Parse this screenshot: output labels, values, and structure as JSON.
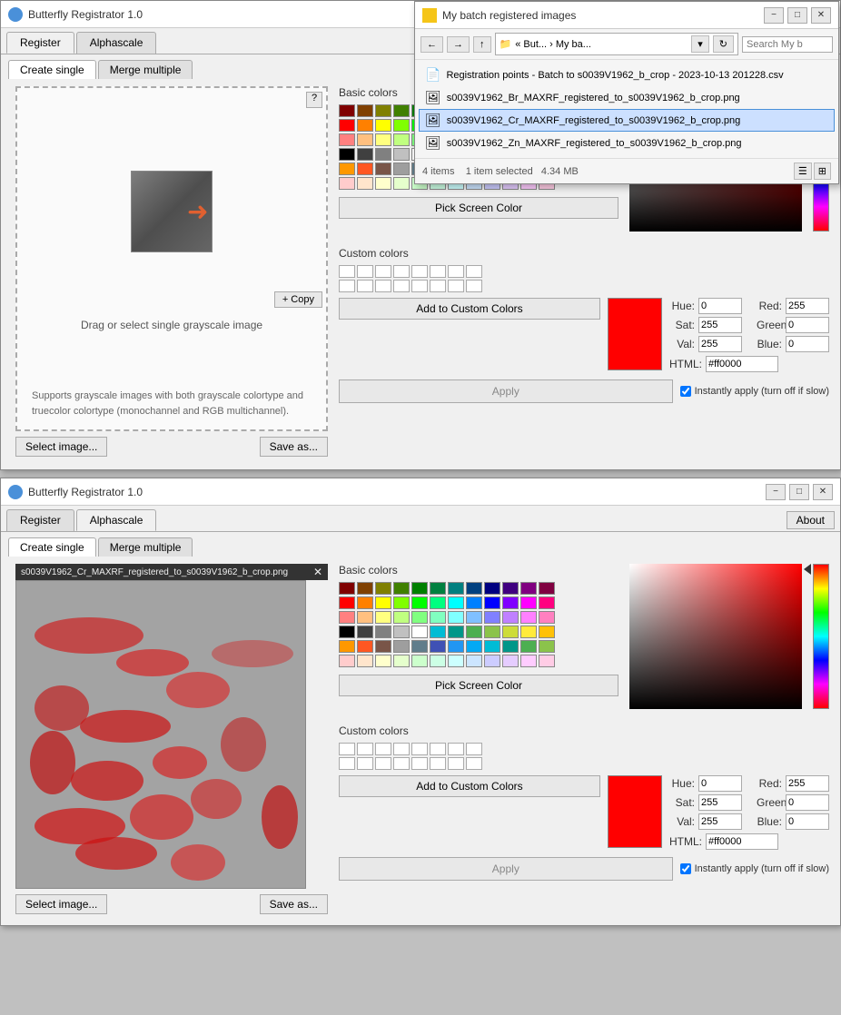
{
  "app": {
    "title": "Butterfly Registrator 1.0",
    "icon": "butterfly-icon"
  },
  "tabs": {
    "register_label": "Register",
    "alphascale_label": "Alphascale",
    "about_label": "About"
  },
  "inner_tabs": {
    "create_single_label": "Create single",
    "merge_multiple_label": "Merge multiple"
  },
  "drop_zone": {
    "help_label": "?",
    "copy_label": "+ Copy",
    "drag_label": "Drag or select single grayscale image",
    "info_text": "Supports grayscale images with both grayscale colortype and truecolor colortype (monochannel and RGB multichannel).",
    "select_btn": "Select image...",
    "save_as_btn": "Save as..."
  },
  "color_picker": {
    "basic_colors_label": "Basic colors",
    "pick_screen_label": "Pick Screen Color",
    "custom_colors_label": "Custom colors",
    "add_custom_label": "Add to Custom Colors",
    "apply_label": "Apply",
    "instantly_label": "Instantly apply (turn off if slow)",
    "hue_label": "Hue:",
    "sat_label": "Sat:",
    "val_label": "Val:",
    "red_label": "Red:",
    "green_label": "Green:",
    "blue_label": "Blue:",
    "html_label": "HTML:",
    "hue_val": "0",
    "sat_val": "255",
    "val_val": "255",
    "red_val": "255",
    "green_val": "0",
    "blue_val": "0",
    "html_val": "#ff0000"
  },
  "basic_colors": [
    "#800000",
    "#804000",
    "#808000",
    "#408000",
    "#008000",
    "#008040",
    "#008080",
    "#004080",
    "#000080",
    "#400080",
    "#800080",
    "#800040",
    "#ff0000",
    "#ff8000",
    "#ffff00",
    "#80ff00",
    "#00ff00",
    "#00ff80",
    "#00ffff",
    "#0080ff",
    "#0000ff",
    "#8000ff",
    "#ff00ff",
    "#ff0080",
    "#ff8080",
    "#ffc080",
    "#ffff80",
    "#c0ff80",
    "#80ff80",
    "#80ffc0",
    "#80ffff",
    "#80c0ff",
    "#8080ff",
    "#c080ff",
    "#ff80ff",
    "#ff80c0",
    "#000000",
    "#404040",
    "#808080",
    "#c0c0c0",
    "#ffffff",
    "#00bcd4",
    "#009688",
    "#4caf50",
    "#8bc34a",
    "#cddc39",
    "#ffeb3b",
    "#ffc107",
    "#ff9800",
    "#ff5722",
    "#795548",
    "#9e9e9e",
    "#607d8b",
    "#3f51b5",
    "#2196f3",
    "#03a9f4",
    "#00bcd5",
    "#009689",
    "#4caf51",
    "#8bc34b",
    "#ffcccc",
    "#ffe5cc",
    "#ffffcc",
    "#e5ffcc",
    "#ccffcc",
    "#ccffe5",
    "#ccffff",
    "#cce5ff",
    "#ccccff",
    "#e5ccff",
    "#ffccff",
    "#ffcce5"
  ],
  "file_browser": {
    "title": "My batch registered images",
    "addr": "« But... › My ba...",
    "search_placeholder": "Search My b",
    "files": [
      {
        "name": "Registration points - Batch to s0039V1962_b_crop - 2023-10-13 201228.csv",
        "type": "csv",
        "selected": false
      },
      {
        "name": "s0039V1962_Br_MAXRF_registered_to_s0039V1962_b_crop.png",
        "type": "png",
        "selected": false
      },
      {
        "name": "s0039V1962_Cr_MAXRF_registered_to_s0039V1962_b_crop.png",
        "type": "png",
        "selected": true
      },
      {
        "name": "s0039V1962_Zn_MAXRF_registered_to_s0039V1962_b_crop.png",
        "type": "png",
        "selected": false
      }
    ],
    "footer_items": "4 items",
    "footer_selected": "1 item selected",
    "footer_size": "4.34 MB"
  },
  "bottom_window": {
    "image_filename": "s0039V1962_Cr_MAXRF_registered_to_s0039V1962_b_crop.png"
  },
  "window_controls": {
    "minimize": "−",
    "maximize": "□",
    "close": "✕"
  }
}
